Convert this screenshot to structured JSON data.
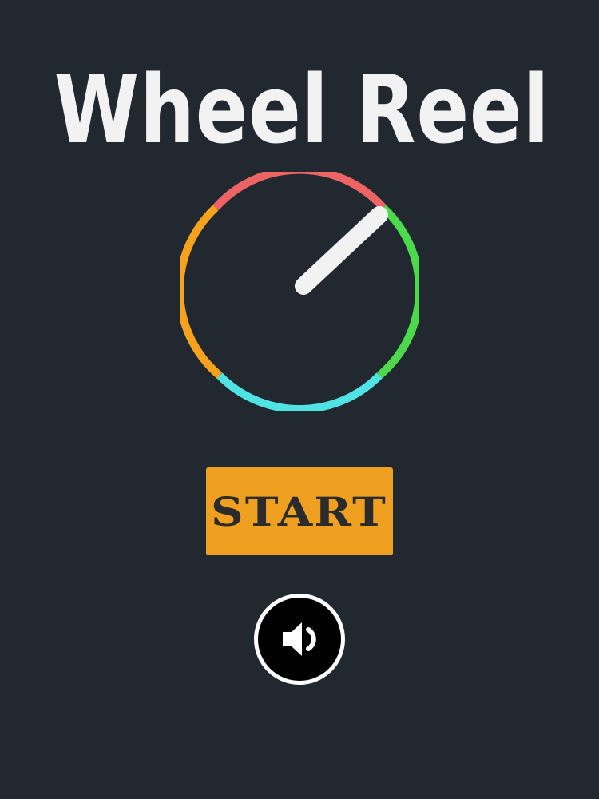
{
  "game": {
    "title": "Wheel Reel"
  },
  "wheel": {
    "segments": [
      {
        "name": "red",
        "color": "#ee6464"
      },
      {
        "name": "green",
        "color": "#4cd94c"
      },
      {
        "name": "cyan",
        "color": "#50e3e3"
      },
      {
        "name": "orange",
        "color": "#f5a31c"
      }
    ],
    "needle_color": "#f2f2f2",
    "needle_angle_deg": 45
  },
  "buttons": {
    "start_label": "START",
    "sound_icon": "speaker-icon"
  },
  "colors": {
    "background": "#212830",
    "start_button": "#f0a020",
    "start_text": "#2b2b2b",
    "title": "#f2f2f2"
  }
}
